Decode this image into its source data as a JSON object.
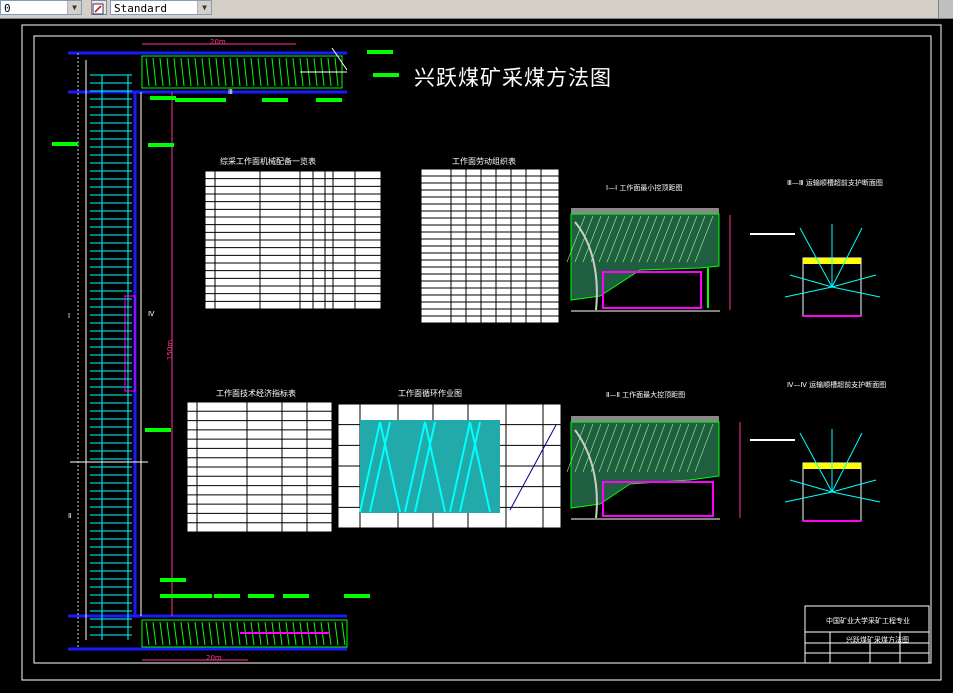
{
  "toolbar": {
    "layer_value": "0",
    "style_value": "Standard"
  },
  "drawing": {
    "title": "兴跃煤矿采煤方法图",
    "table1_title": "综采工作面机械配备一览表",
    "table2_title": "工作面劳动组织表",
    "table3_title": "工作面技术经济指标表",
    "table4_title": "工作面循环作业图",
    "section1_title": "Ⅰ—Ⅰ 工作面最小控顶距图",
    "section2_title": "Ⅱ—Ⅱ 工作面最大控顶距图",
    "section3_title": "Ⅲ—Ⅲ 运输顺槽超前支护断面图",
    "section4_title": "Ⅳ—Ⅳ 运输顺槽超前支护断面图",
    "dim_top": "20m",
    "dim_bottom": "20m",
    "dim_side": "150m",
    "marker_I": "Ⅰ",
    "marker_II": "Ⅱ",
    "marker_III": "Ⅲ",
    "marker_IV": "Ⅳ",
    "title_block_school": "中国矿业大学采矿工程专业",
    "title_block_name": "兴跃煤矿采煤方法图"
  },
  "colors": {
    "background": "#000000",
    "frame": "#ffffff",
    "roadway": "#1a1aff",
    "hatch": "#00ff00",
    "support": "#00ffff",
    "equipment": "#ff00ff",
    "dimension": "#ff3399"
  }
}
